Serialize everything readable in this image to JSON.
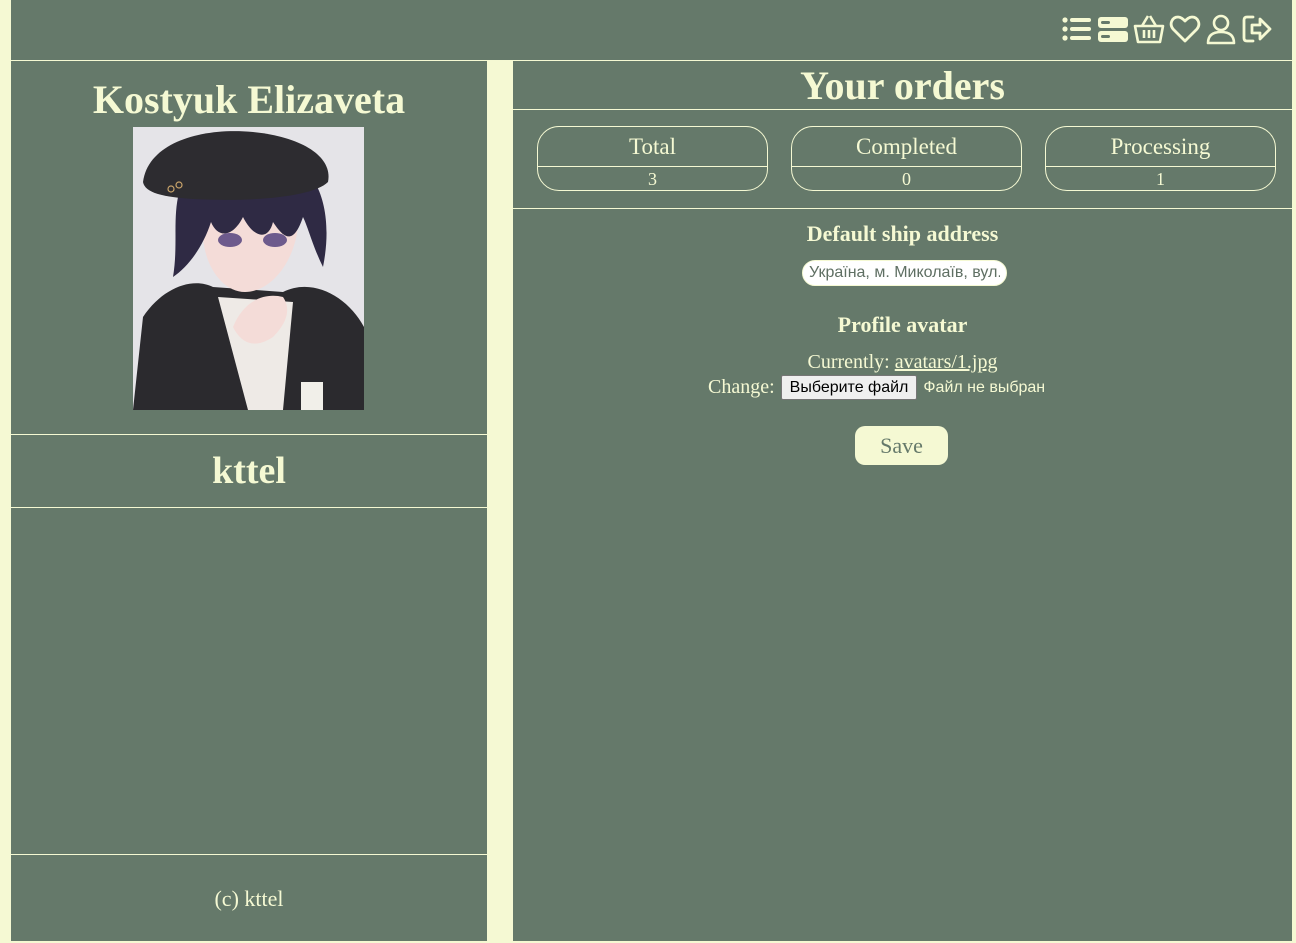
{
  "header": {
    "icons": [
      "list-icon",
      "catalog-icon",
      "basket-icon",
      "heart-icon",
      "user-icon",
      "logout-icon"
    ]
  },
  "profile": {
    "full_name": "Kostyuk Elizaveta",
    "username": "kttel",
    "footer": "(c) kttel"
  },
  "orders": {
    "title": "Your orders",
    "stats": [
      {
        "label": "Total",
        "value": "3"
      },
      {
        "label": "Completed",
        "value": "0"
      },
      {
        "label": "Processing",
        "value": "1"
      }
    ]
  },
  "address": {
    "title": "Default ship address",
    "value": "Україна, м. Миколаїв, вул."
  },
  "avatar": {
    "title": "Profile avatar",
    "currently_label": "Currently:",
    "current_file": "avatars/1.jpg",
    "change_label": "Change:",
    "choose_button": "Выберите файл",
    "no_file_text": "Файл не выбран"
  },
  "save_label": "Save",
  "colors": {
    "background": "#65796a",
    "accent": "#f5f9d3"
  }
}
